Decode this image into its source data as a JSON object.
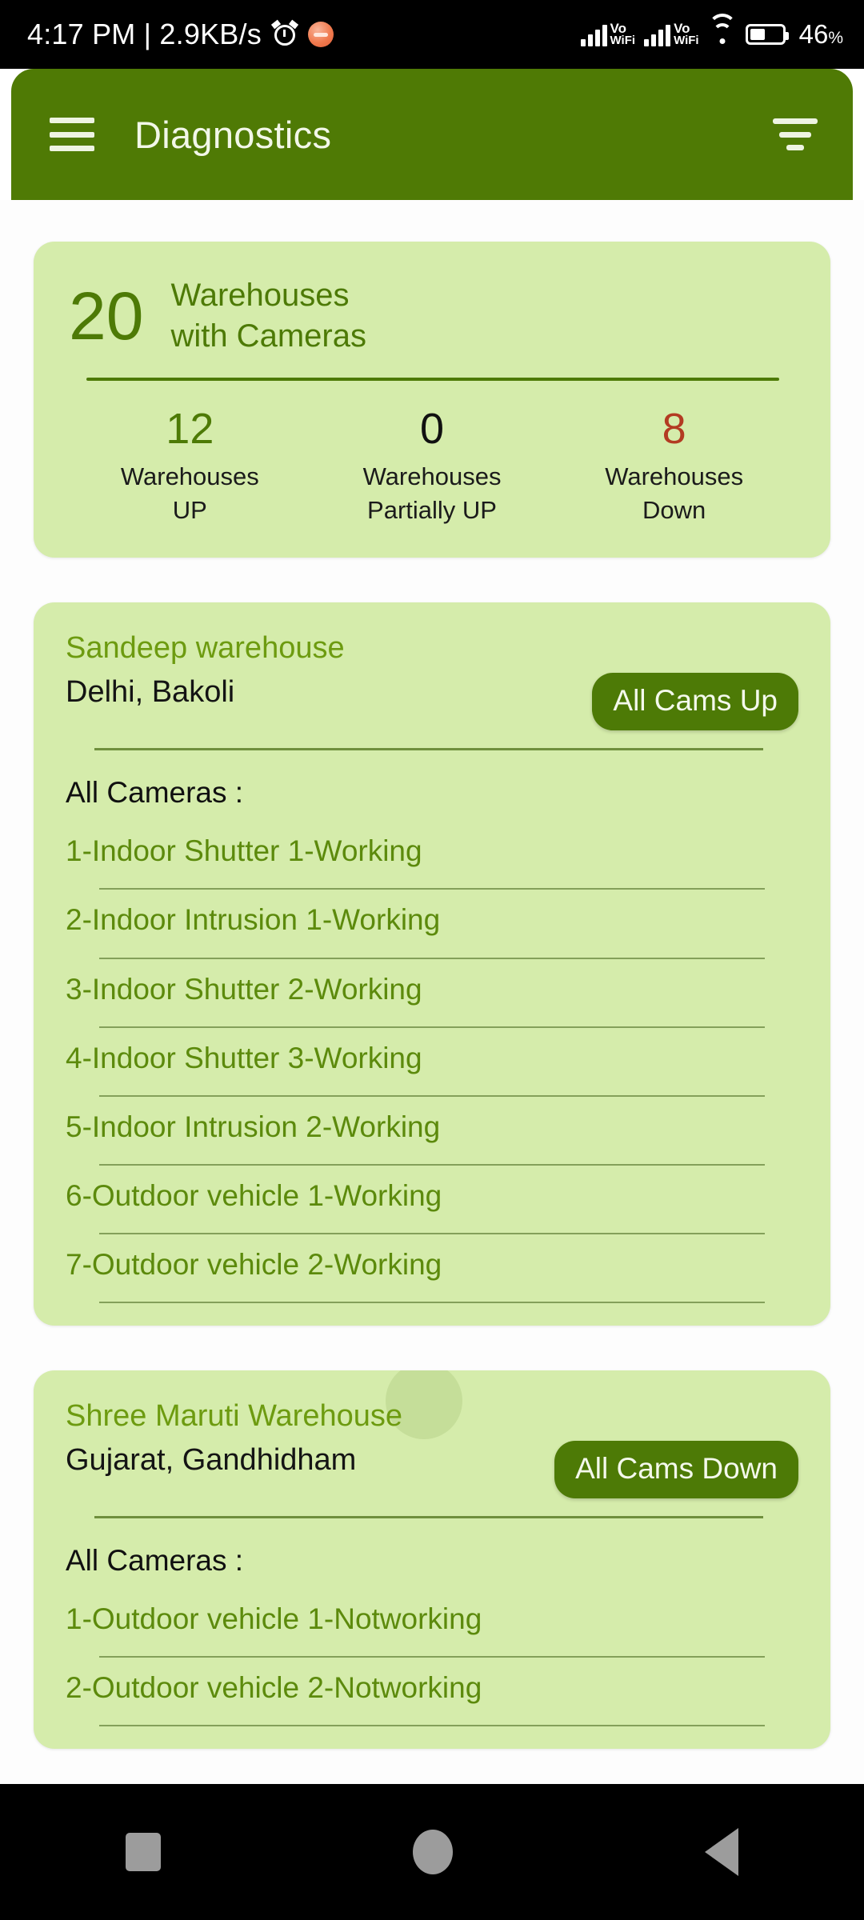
{
  "statusbar": {
    "time_and_net": "4:17 PM | 2.9KB/s",
    "alarm_icon": "alarm-icon",
    "mute_icon": "mute-notification-icon",
    "sim1_label_top": "Vo",
    "sim1_label_bottom": "WiFi",
    "sim2_label_top": "Vo",
    "sim2_label_bottom": "WiFi",
    "wifi_icon": "wifi-icon",
    "battery_level": "46",
    "battery_pct": "%"
  },
  "appbar": {
    "menu_icon": "hamburger-menu-icon",
    "title": "Diagnostics",
    "filter_icon": "filter-icon"
  },
  "summary": {
    "count": "20",
    "label_line1": "Warehouses",
    "label_line2": "with Cameras",
    "stats": [
      {
        "num": "12",
        "caption_line1": "Warehouses",
        "caption_line2": "UP",
        "color": "#4d7a06"
      },
      {
        "num": "0",
        "caption_line1": "Warehouses",
        "caption_line2": "Partially UP",
        "color": "#111111"
      },
      {
        "num": "8",
        "caption_line1": "Warehouses",
        "caption_line2": "Down",
        "color": "#b33b22"
      }
    ]
  },
  "cameras_heading": "All Cameras :",
  "warehouses": [
    {
      "name": "Sandeep warehouse",
      "location": "Delhi, Bakoli",
      "status_badge": "All Cams Up",
      "cameras": [
        "1-Indoor Shutter 1-Working",
        "2-Indoor Intrusion 1-Working",
        "3-Indoor Shutter 2-Working",
        "4-Indoor Shutter 3-Working",
        "5-Indoor Intrusion 2-Working",
        "6-Outdoor vehicle 1-Working",
        "7-Outdoor vehicle 2-Working"
      ]
    },
    {
      "name": "Shree Maruti Warehouse",
      "location": "Gujarat, Gandhidham",
      "status_badge": "All Cams Down",
      "cameras": [
        "1-Outdoor vehicle 1-Notworking",
        "2-Outdoor vehicle 2-Notworking"
      ]
    }
  ],
  "navbar": {
    "recent_icon": "recent-apps-icon",
    "home_icon": "home-icon",
    "back_icon": "back-icon"
  },
  "colors": {
    "appbar_green": "#4f7a05",
    "card_green": "#d5ecab",
    "accent_green": "#4d7a06",
    "status_down_red": "#b33b22"
  }
}
